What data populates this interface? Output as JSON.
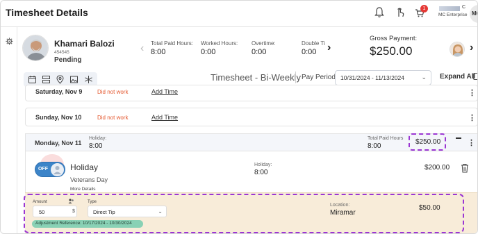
{
  "header": {
    "title": "Timesheet Details",
    "notification_count": "1",
    "user_initial": "C",
    "company": "MC Enterprise",
    "avatar_initials": "MC"
  },
  "employee": {
    "name": "Khamari Balozi",
    "id": "454545",
    "status": "Pending"
  },
  "stats": [
    {
      "label": "Total Paid Hours:",
      "value": "8:00"
    },
    {
      "label": "Worked Hours:",
      "value": "0:00"
    },
    {
      "label": "Overtime:",
      "value": "0:00"
    },
    {
      "label": "Double Ti",
      "value": "0:00"
    }
  ],
  "gross": {
    "label": "Gross Payment:",
    "value": "$250.00"
  },
  "toolbar": {
    "view_title": "Timesheet - Bi-Weekly",
    "pay_period_label": "Pay Period:",
    "pay_period_value": "10/31/2024 - 11/13/2024",
    "expand_all": "Expand All"
  },
  "days": [
    {
      "name": "Saturday, Nov 9",
      "status": "Did not work",
      "action": "Add Time"
    },
    {
      "name": "Sunday, Nov 10",
      "status": "Did not work",
      "action": "Add Time"
    }
  ],
  "monday": {
    "name": "Monday, Nov 11",
    "holiday_label": "Holiday:",
    "holiday_hours": "8:00",
    "total_paid_label": "Total Paid Hours",
    "total_paid_hours": "8:00",
    "total_amount": "$250.00"
  },
  "holiday_entry": {
    "toggle_label": "OFF",
    "title": "Holiday",
    "subtitle": "Veterans Day",
    "more": "More Details",
    "hours_label": "Holiday:",
    "hours_value": "8:00",
    "amount": "$200.00"
  },
  "adjustment": {
    "amount_label": "Amount",
    "amount_value": "50",
    "amount_unit": "$",
    "type_label": "Type",
    "type_value": "Direct Tip",
    "reference": "Adjustment Reference: 10/17/2024 - 10/30/2024",
    "location_label": "Location:",
    "location_value": "Miramar",
    "amount_display": "$50.00"
  },
  "colors": {
    "highlight_dash": "#9b36d3",
    "adjust_bg": "#f8ecd9",
    "chip_bg": "#89d1b5",
    "did_not_work": "#e4572e",
    "toggle_blue": "#3c84c8"
  }
}
